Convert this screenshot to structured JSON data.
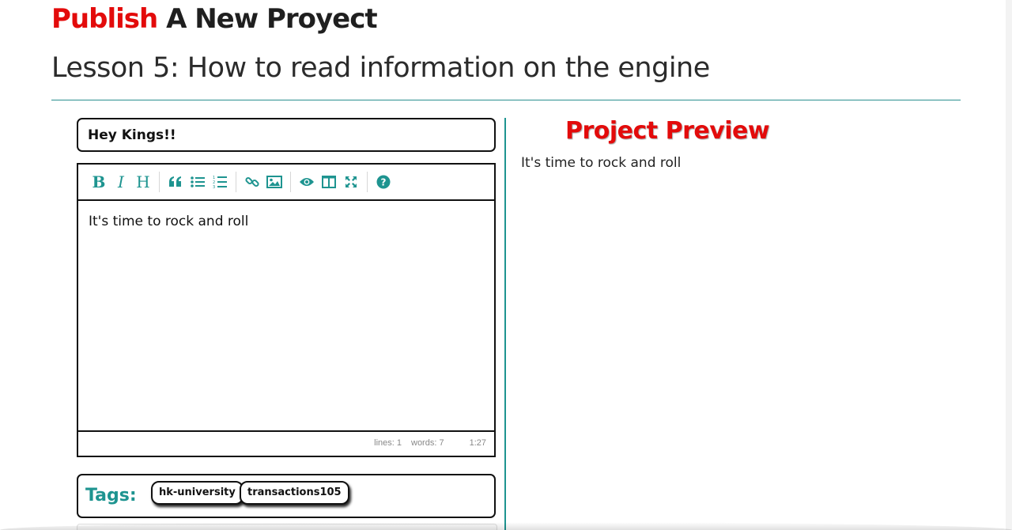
{
  "header": {
    "title_accent": "Publish",
    "title_rest": "A New Proyect",
    "lesson_title": "Lesson 5: How to read information on the engine"
  },
  "form": {
    "title_value": "Hey Kings!!",
    "editor": {
      "toolbar": {
        "bold": "B",
        "italic": "I",
        "heading": "H",
        "icons": [
          "bold-icon",
          "italic-icon",
          "heading-icon",
          "quote-icon",
          "unordered-list-icon",
          "ordered-list-icon",
          "link-icon",
          "image-icon",
          "preview-icon",
          "side-by-side-icon",
          "fullscreen-icon",
          "help-icon"
        ]
      },
      "content": "It's time to rock and roll",
      "status": {
        "lines": "lines: 1",
        "words": "words: 7",
        "cursor": "1:27"
      }
    },
    "tags": {
      "label": "Tags:",
      "items": [
        "hk-university",
        "transactions105"
      ]
    }
  },
  "preview": {
    "title": "Project Preview",
    "body": "It's time to rock and roll"
  },
  "colors": {
    "accent_red": "#e30b0b",
    "teal": "#1e9490",
    "text_dark": "#1f1f1f"
  }
}
